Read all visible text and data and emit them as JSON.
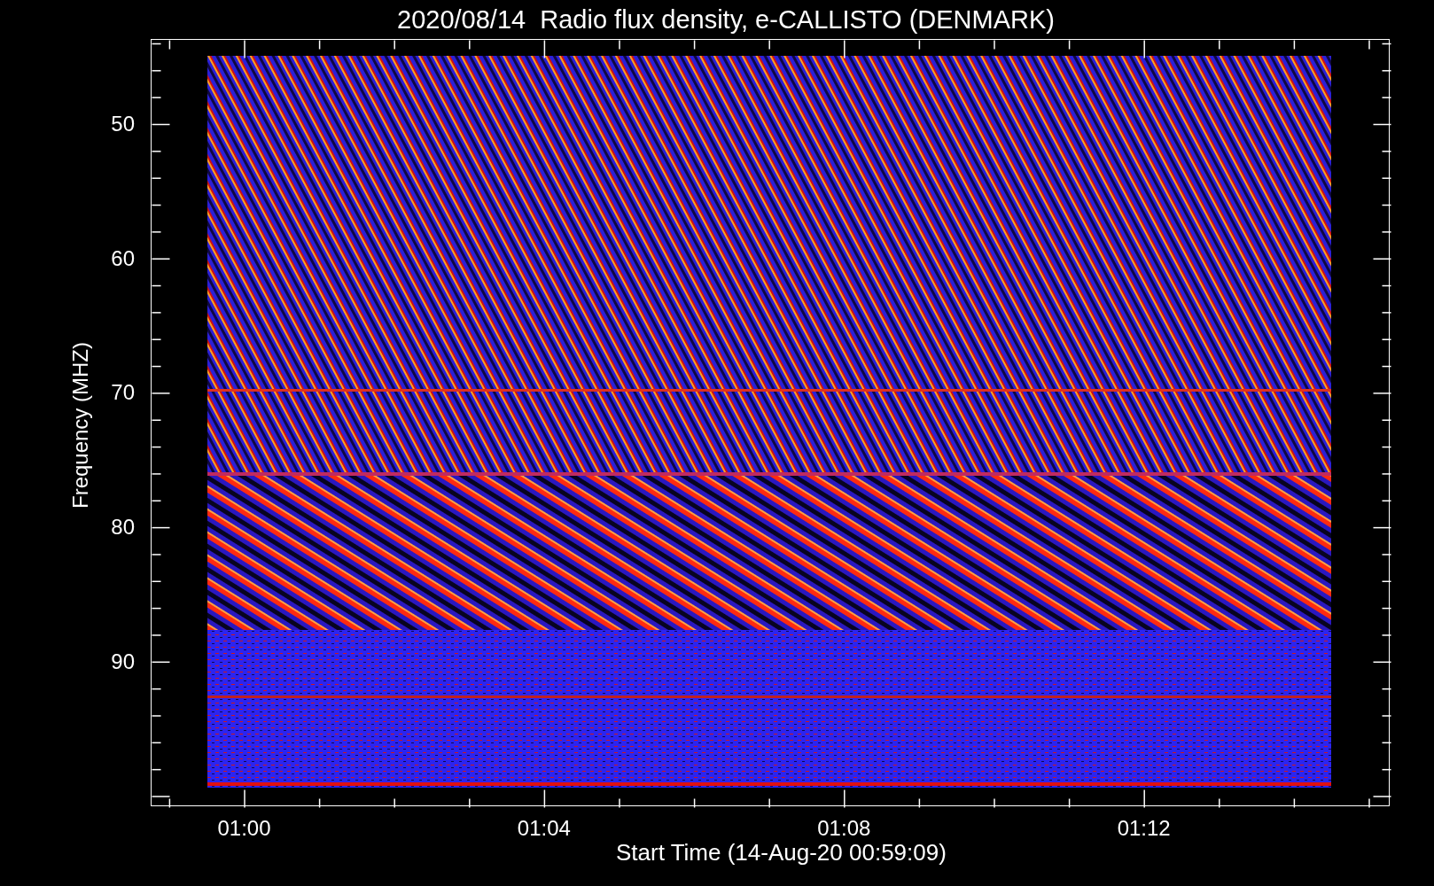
{
  "title": "2020/08/14  Radio flux density, e-CALLISTO (DENMARK)",
  "y_axis": {
    "label": "Frequency (MHZ)",
    "ticks": [
      "50",
      "60",
      "70",
      "80",
      "90"
    ]
  },
  "x_axis": {
    "label": "Start Time (14-Aug-20 00:59:09)",
    "ticks": [
      "01:00",
      "01:04",
      "01:08",
      "01:12"
    ]
  }
}
